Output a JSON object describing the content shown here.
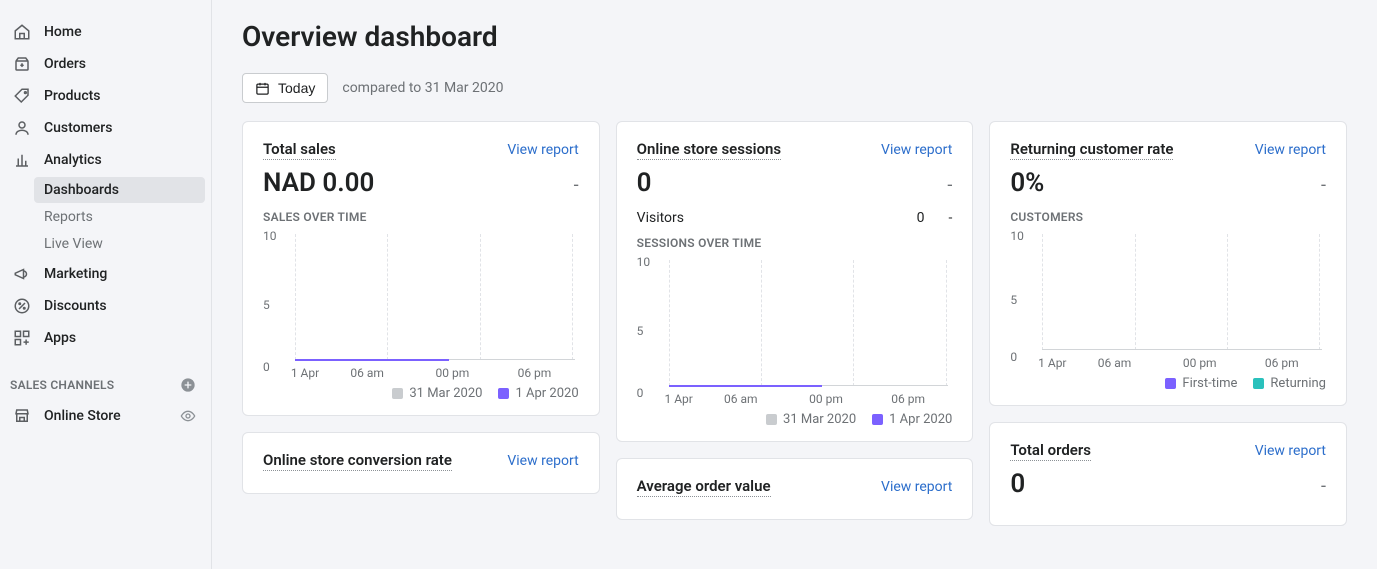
{
  "sidebar": {
    "items": [
      {
        "label": "Home"
      },
      {
        "label": "Orders"
      },
      {
        "label": "Products"
      },
      {
        "label": "Customers"
      },
      {
        "label": "Analytics"
      }
    ],
    "analytics_sub": [
      {
        "label": "Dashboards",
        "active": true
      },
      {
        "label": "Reports"
      },
      {
        "label": "Live View"
      }
    ],
    "items2": [
      {
        "label": "Marketing"
      },
      {
        "label": "Discounts"
      },
      {
        "label": "Apps"
      }
    ],
    "channels_header": "SALES CHANNELS",
    "channels": [
      {
        "label": "Online Store"
      }
    ]
  },
  "page": {
    "title": "Overview dashboard",
    "date_button": "Today",
    "compare_text": "compared to 31 Mar 2020"
  },
  "cards": {
    "total_sales": {
      "title": "Total sales",
      "link": "View report",
      "value": "NAD 0.00",
      "delta": "-",
      "overline": "SALES OVER TIME"
    },
    "sessions": {
      "title": "Online store sessions",
      "link": "View report",
      "value": "0",
      "delta": "-",
      "visitors_label": "Visitors",
      "visitors_value": "0",
      "visitors_delta": "-",
      "overline": "SESSIONS OVER TIME"
    },
    "returning": {
      "title": "Returning customer rate",
      "link": "View report",
      "value": "0%",
      "delta": "-",
      "overline": "CUSTOMERS"
    },
    "conversion": {
      "title": "Online store conversion rate",
      "link": "View report"
    },
    "avg_order": {
      "title": "Average order value",
      "link": "View report"
    },
    "total_orders": {
      "title": "Total orders",
      "link": "View report",
      "value": "0",
      "delta": "-"
    }
  },
  "legend": {
    "prev": "31 Mar 2020",
    "cur": "1 Apr 2020",
    "first_time": "First-time",
    "returning": "Returning"
  },
  "colors": {
    "prev": "#c9cccf",
    "cur": "#7b61ff",
    "first_time": "#7b61ff",
    "returning": "#2ac1bc"
  },
  "chart_data": [
    {
      "id": "sales_over_time",
      "type": "line",
      "title": "SALES OVER TIME",
      "xlabel": "",
      "ylabel": "",
      "ylim": [
        0,
        10
      ],
      "yticks": [
        0,
        5,
        10
      ],
      "categories": [
        "1 Apr",
        "06 am",
        "00 pm",
        "06 pm"
      ],
      "series": [
        {
          "name": "31 Mar 2020",
          "values": [
            0,
            0,
            0,
            0
          ]
        },
        {
          "name": "1 Apr 2020",
          "values": [
            0,
            0,
            0,
            null
          ]
        }
      ]
    },
    {
      "id": "sessions_over_time",
      "type": "line",
      "title": "SESSIONS OVER TIME",
      "xlabel": "",
      "ylabel": "",
      "ylim": [
        0,
        10
      ],
      "yticks": [
        0,
        5,
        10
      ],
      "categories": [
        "1 Apr",
        "06 am",
        "00 pm",
        "06 pm"
      ],
      "series": [
        {
          "name": "31 Mar 2020",
          "values": [
            0,
            0,
            0,
            0
          ]
        },
        {
          "name": "1 Apr 2020",
          "values": [
            0,
            0,
            0,
            null
          ]
        }
      ]
    },
    {
      "id": "customers",
      "type": "line",
      "title": "CUSTOMERS",
      "xlabel": "",
      "ylabel": "",
      "ylim": [
        0,
        10
      ],
      "yticks": [
        0,
        5,
        10
      ],
      "categories": [
        "1 Apr",
        "06 am",
        "00 pm",
        "06 pm"
      ],
      "series": [
        {
          "name": "First-time",
          "values": [
            0,
            0,
            0,
            0
          ]
        },
        {
          "name": "Returning",
          "values": [
            0,
            0,
            0,
            0
          ]
        }
      ]
    }
  ]
}
